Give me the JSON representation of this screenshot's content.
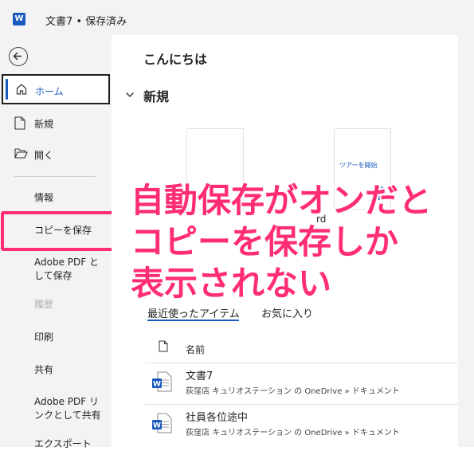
{
  "titlebar": {
    "doc_title": "文書7 • 保存済み",
    "app_icon": "word-icon"
  },
  "sidebar": {
    "back_icon": "back-arrow-icon",
    "home_label": "ホーム",
    "new_label": "新規",
    "open_label": "開く",
    "info_label": "情報",
    "save_copy_label": "コピーを保存",
    "adobe_pdf_save_label": "Adobe PDF と\nして保存",
    "history_label": "履歴",
    "print_label": "印刷",
    "share_label": "共有",
    "adobe_pdf_share_label": "Adobe PDF リ\nンクとして共有",
    "export_label": "エクスポート"
  },
  "main": {
    "greeting": "こんにちは",
    "new_heading": "新規",
    "templates": {
      "tour_caption": "ツアーを開始",
      "tour_name_fragment": "rd"
    },
    "tabs": {
      "recent": "最近使ったアイテム",
      "favorites": "お気に入り"
    },
    "list_header_name": "名前",
    "files": [
      {
        "name": "文書7",
        "path": "荻窪店 キュリオステーション の OneDrive » ドキュメント"
      },
      {
        "name": "社員各位途中",
        "path": "荻窪店 キュリオステーション の OneDrive » ドキュメント"
      }
    ]
  },
  "annotation": {
    "line1": "自動保存がオンだと",
    "line2": "コピーを保存しか",
    "line3": "表示されない",
    "color": "#ff2d76"
  }
}
